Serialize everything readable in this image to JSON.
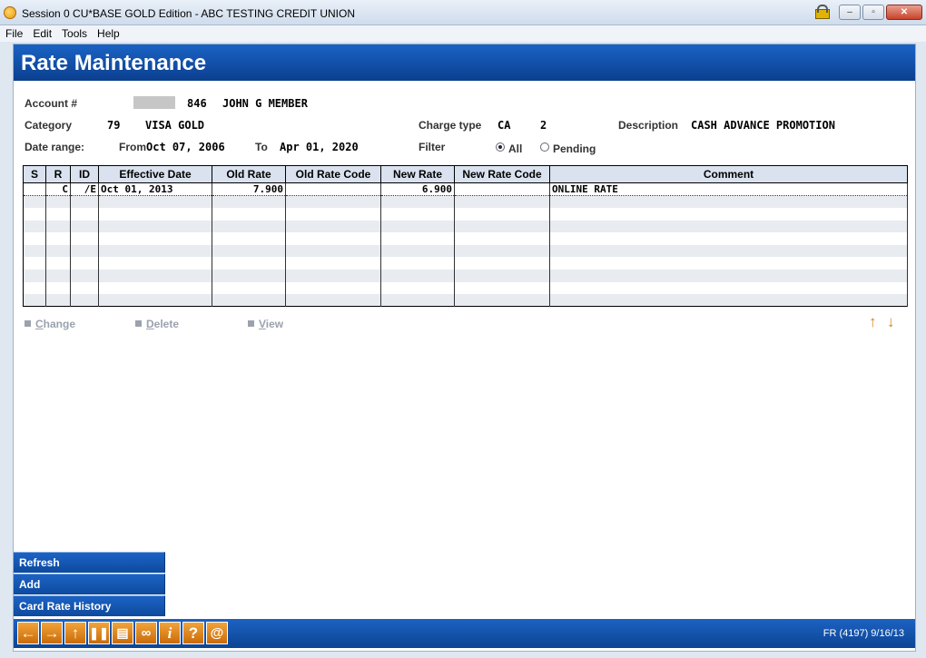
{
  "window": {
    "title": "Session 0 CU*BASE GOLD Edition - ABC TESTING CREDIT UNION",
    "min_label": "–",
    "max_label": "▫",
    "close_label": "✕"
  },
  "menu": [
    "File",
    "Edit",
    "Tools",
    "Help"
  ],
  "page_title": "Rate Maintenance",
  "account": {
    "label": "Account #",
    "number_suffix": "846",
    "name": "JOHN G MEMBER"
  },
  "category": {
    "label": "Category",
    "code": "79",
    "name": "VISA GOLD"
  },
  "charge_type": {
    "label": "Charge type",
    "code": "CA",
    "number": "2"
  },
  "description": {
    "label": "Description",
    "value": "CASH ADVANCE PROMOTION"
  },
  "date_range": {
    "label": "Date range:",
    "from_label": "From",
    "from": "Oct 07, 2006",
    "to_label": "To",
    "to": "Apr 01, 2020"
  },
  "filter": {
    "label": "Filter",
    "options": [
      {
        "label": "All",
        "selected": true
      },
      {
        "label": "Pending",
        "selected": false
      }
    ]
  },
  "table": {
    "columns": [
      "S",
      "R",
      "ID",
      "Effective Date",
      "Old Rate",
      "Old Rate Code",
      "New Rate",
      "New Rate Code",
      "Comment"
    ],
    "rows": [
      [
        "",
        "C",
        "/E",
        "Oct 01, 2013",
        "7.900",
        "",
        "6.900",
        "",
        "ONLINE RATE"
      ]
    ]
  },
  "actions": {
    "change": {
      "underline": "C",
      "rest": "hange"
    },
    "delete": {
      "underline": "D",
      "rest": "elete"
    },
    "view": {
      "underline": "V",
      "rest": "iew"
    }
  },
  "side_buttons": [
    "Refresh",
    "Add",
    "Card Rate History"
  ],
  "toolbar_icons": [
    "back-icon",
    "forward-icon",
    "up-icon",
    "pause-icon",
    "print-icon",
    "link-icon",
    "info-icon",
    "help-icon",
    "email-icon"
  ],
  "footer_code": "FR (4197) 9/16/13",
  "colors": {
    "header_blue": "#0b3f8f",
    "accent_orange": "#d9801c"
  }
}
